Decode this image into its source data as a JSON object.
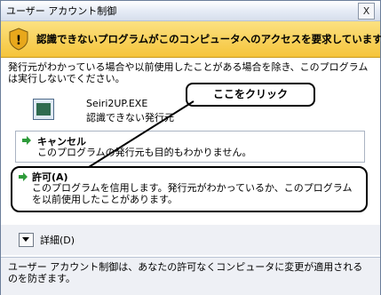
{
  "window": {
    "title": "ユーザー アカウント制御",
    "close_label": "X"
  },
  "banner": {
    "text": "認識できないプログラムがこのコンピュータへのアクセスを要求しています"
  },
  "intro": "発行元がわかっている場合や以前使用したことがある場合を除き、このプログラムは実行しないでください。",
  "program": {
    "name": "Seiri2UP.EXE",
    "publisher": "認識できない発行元"
  },
  "annotation": "ここをクリック",
  "cancel": {
    "title": "キャンセル",
    "desc": "このプログラムの発行元も目的もわかりません。"
  },
  "allow": {
    "title": "許可(A)",
    "desc": "このプログラムを信用します。発行元がわかっているか、このプログラムを以前使用したことがあります。"
  },
  "details": {
    "label": "詳細(D)"
  },
  "footer": "ユーザー アカウント制御は、あなたの許可なくコンピュータに変更が適用されるのを防ぎます。",
  "colors": {
    "banner_top": "#fce182",
    "banner_bottom": "#f5c43a",
    "arrow_green": "#2e9b3a"
  }
}
